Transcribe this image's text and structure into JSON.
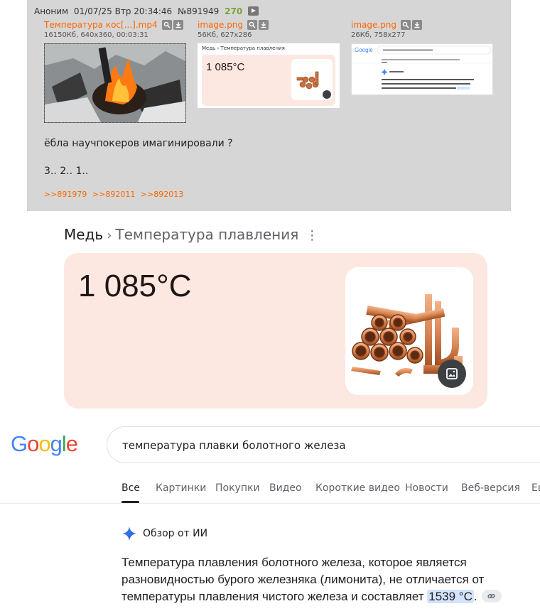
{
  "post": {
    "header": {
      "name": "Аноним",
      "datetime": "01/07/25 Втр 20:34:46",
      "number": "№891949",
      "replies": "270"
    },
    "files": [
      {
        "name": "Температура кос[...].mp4",
        "meta": "16150Кб, 640x360, 00:03:31"
      },
      {
        "name": "image.png",
        "meta": "56Кб, 627x286"
      },
      {
        "name": "image.png",
        "meta": "26Кб, 758x277"
      }
    ],
    "thumb_copper": {
      "crumb": "Медь › Температура плавления",
      "value": "1 085°C"
    },
    "text_lines": [
      "ёбла научпокеров имагинировали ?",
      "3.. 2.. 1.."
    ],
    "backlinks": [
      ">>891979",
      ">>892011",
      ">>892013"
    ]
  },
  "copper": {
    "crumb_main": "Медь",
    "crumb_sep": "›",
    "crumb_sub": "Температура плавления",
    "more": "⋮",
    "value": "1 085°C"
  },
  "google": {
    "logo": "Google",
    "query": "температура плавки болотного железа",
    "tabs": [
      "Все",
      "Картинки",
      "Покупки",
      "Видео",
      "Короткие видео",
      "Новости",
      "Веб-версия",
      "Ещ"
    ],
    "ai_title": "Обзор от ИИ",
    "ai_text_before": "Температура плавления болотного железа, которое является разновидностью бурого железняка (лимонита), не отличается от температуры плавления чистого железа и составляет ",
    "ai_highlight": "1539 °C",
    "ai_text_after": ".",
    "colors": {
      "blue": "#4285F4",
      "red": "#EA4335",
      "yellow": "#FBBC05",
      "green": "#34A853"
    }
  }
}
